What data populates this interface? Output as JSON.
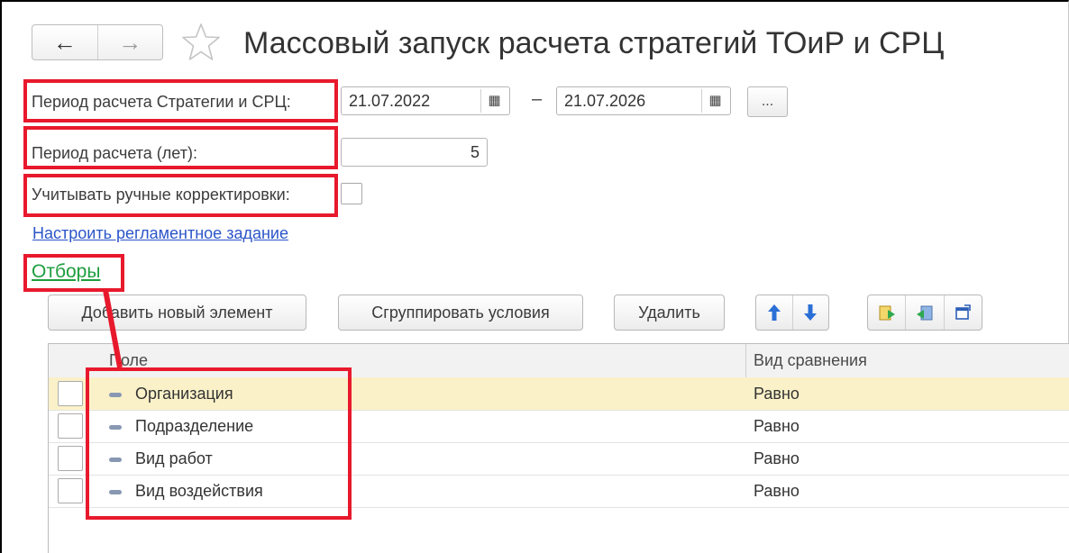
{
  "header": {
    "back_icon": "arrow-left-icon",
    "forward_icon": "arrow-right-icon",
    "favorite_icon": "star-icon",
    "title": "Массовый запуск расчета стратегий ТОиР и СРЦ"
  },
  "form": {
    "period_label": "Период расчета Стратегии и СРЦ:",
    "date_from": "21.07.2022",
    "date_separator": "–",
    "date_to": "21.07.2026",
    "period_more_label": "...",
    "years_label": "Период расчета (лет):",
    "years_value": "5",
    "manual_corrections_label": "Учитывать ручные корректировки:",
    "manual_corrections_checked": false,
    "schedule_link": "Настроить регламентное задание"
  },
  "filters": {
    "section_title": "Отборы",
    "toolbar": {
      "add_label": "Добавить новый элемент",
      "group_label": "Сгруппировать условия",
      "delete_label": "Удалить",
      "move_up_icon": "arrow-up-icon",
      "move_down_icon": "arrow-down-icon",
      "icons": [
        "add-to-group-icon",
        "remove-from-group-icon",
        "open-icon"
      ]
    },
    "columns": [
      "Поле",
      "Вид сравнения"
    ],
    "rows": [
      {
        "field": "Организация",
        "comparison": "Равно",
        "selected": true
      },
      {
        "field": "Подразделение",
        "comparison": "Равно",
        "selected": false
      },
      {
        "field": "Вид работ",
        "comparison": "Равно",
        "selected": false
      },
      {
        "field": "Вид воздействия",
        "comparison": "Равно",
        "selected": false
      }
    ]
  },
  "colors": {
    "highlight": "#e8192c",
    "link": "#2b55c8",
    "section_title": "#1e9e3e",
    "selected_row": "#fbf1c8"
  }
}
